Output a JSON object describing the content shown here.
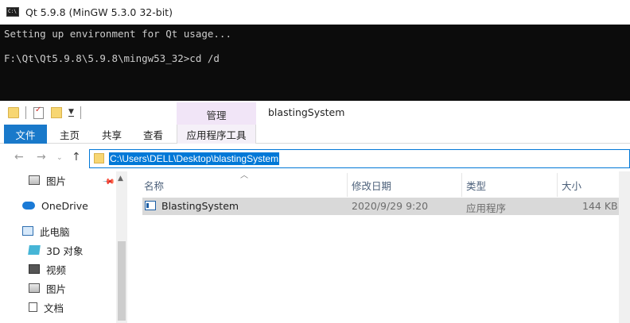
{
  "console": {
    "title": "Qt 5.9.8 (MinGW 5.3.0 32-bit)",
    "lines": [
      "Setting up environment for Qt usage...",
      "",
      "F:\\Qt\\Qt5.9.8\\5.9.8\\mingw53_32>cd /d"
    ]
  },
  "explorer": {
    "context_header": "管理",
    "window_title": "blastingSystem",
    "tabs": {
      "file": "文件",
      "home": "主页",
      "share": "共享",
      "view": "查看",
      "app_tools": "应用程序工具"
    },
    "address": "C:\\Users\\DELL\\Desktop\\blastingSystem",
    "nav_items": [
      {
        "label": "图片",
        "icon": "picture-icon"
      },
      {
        "label": "OneDrive",
        "icon": "onedrive-icon"
      },
      {
        "label": "此电脑",
        "icon": "computer-icon"
      },
      {
        "label": "3D 对象",
        "icon": "3d-objects-icon"
      },
      {
        "label": "视频",
        "icon": "video-icon"
      },
      {
        "label": "图片",
        "icon": "picture-icon"
      },
      {
        "label": "文档",
        "icon": "document-icon"
      }
    ],
    "columns": {
      "name": "名称",
      "modified": "修改日期",
      "type": "类型",
      "size": "大小"
    },
    "files": [
      {
        "name": "BlastingSystem",
        "modified": "2020/9/29 9:20",
        "type": "应用程序",
        "size": "144 KB"
      }
    ]
  }
}
